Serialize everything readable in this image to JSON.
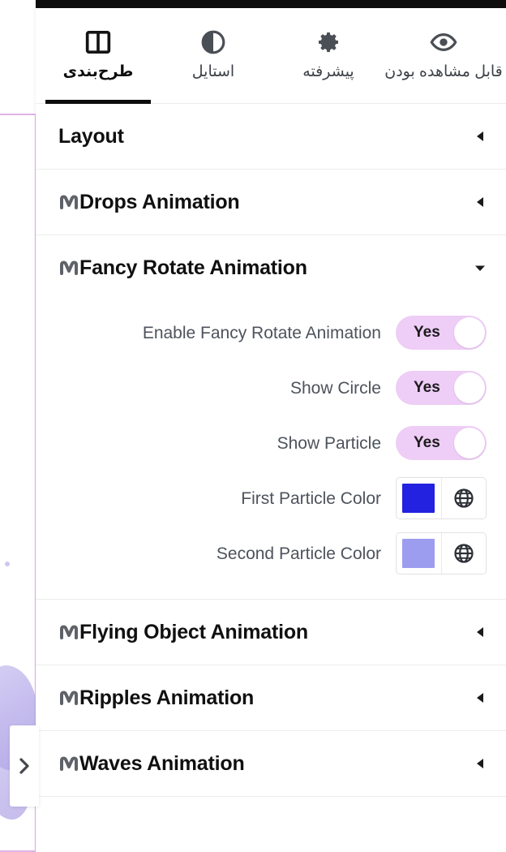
{
  "topbar": {
    "color": "#0d0d0d"
  },
  "tabs": [
    {
      "label": "قابل مشاهده بودن",
      "icon": "eye-icon",
      "active": false
    },
    {
      "label": "پیشرفته",
      "icon": "gear-icon",
      "active": false
    },
    {
      "label": "استایل",
      "icon": "contrast-icon",
      "active": false
    },
    {
      "label": "طرح‌بندی",
      "icon": "layout-columns-icon",
      "active": true
    }
  ],
  "sections": [
    {
      "title": "Layout",
      "pro": false,
      "expanded": false,
      "chevron": "chevron-left-icon"
    },
    {
      "title": "Drops Animation",
      "pro": true,
      "expanded": false,
      "chevron": "chevron-left-icon"
    },
    {
      "title": "Fancy Rotate Animation",
      "pro": true,
      "expanded": true,
      "chevron": "chevron-down-icon"
    },
    {
      "title": "Flying Object Animation",
      "pro": true,
      "expanded": false,
      "chevron": "chevron-left-icon"
    },
    {
      "title": "Ripples Animation",
      "pro": true,
      "expanded": false,
      "chevron": "chevron-left-icon"
    },
    {
      "title": "Waves Animation",
      "pro": true,
      "expanded": false,
      "chevron": "chevron-left-icon"
    }
  ],
  "fancy_rotate_rows": [
    {
      "label": "Enable Fancy Rotate Animation",
      "type": "toggle",
      "value": "Yes"
    },
    {
      "label": "Show Circle",
      "type": "toggle",
      "value": "Yes"
    },
    {
      "label": "Show Particle",
      "type": "toggle",
      "value": "Yes"
    },
    {
      "label": "First Particle Color",
      "type": "color",
      "value": "#2222e0",
      "globe_icon": "globe-icon"
    },
    {
      "label": "Second Particle Color",
      "type": "color",
      "value": "#9d9df0",
      "globe_icon": "globe-icon"
    }
  ],
  "canvas": {
    "handle_icon": "chevron-right-icon",
    "frame_border_color": "#dfb3e8",
    "blob_color": "#b0a3e5"
  },
  "colors": {
    "toggle_on_bg": "#eecdf6",
    "accent_black": "#0d0d0d",
    "label_gray": "#4d535c",
    "divider": "#ececec"
  }
}
